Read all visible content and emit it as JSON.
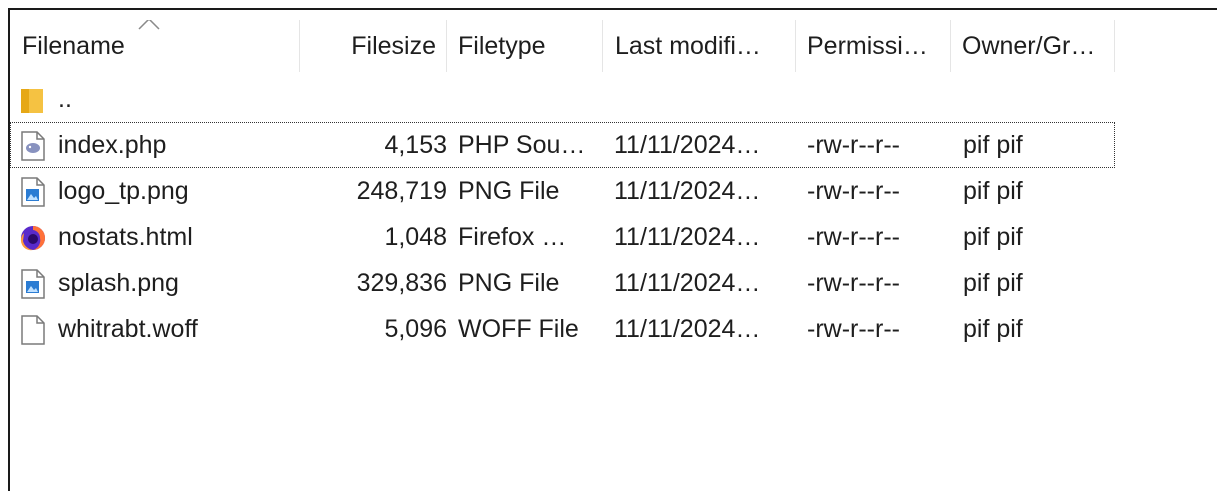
{
  "columns": {
    "filename": "Filename",
    "filesize": "Filesize",
    "filetype": "Filetype",
    "last_modified": "Last modifi…",
    "permissions": "Permissi…",
    "owner_group": "Owner/Gr…"
  },
  "sort": {
    "column": "filename",
    "direction": "ascending"
  },
  "rows": [
    {
      "name": "..",
      "size": "",
      "type": "",
      "modified": "",
      "permissions": "",
      "owner": "",
      "icon": "folder-icon"
    },
    {
      "name": "index.php",
      "size": "4,153",
      "type": "PHP Sou…",
      "modified": "11/11/2024…",
      "permissions": "-rw-r--r--",
      "owner": "pif pif",
      "icon": "php-file-icon"
    },
    {
      "name": "logo_tp.png",
      "size": "248,719",
      "type": "PNG File",
      "modified": "11/11/2024…",
      "permissions": "-rw-r--r--",
      "owner": "pif pif",
      "icon": "image-file-icon"
    },
    {
      "name": "nostats.html",
      "size": "1,048",
      "type": "Firefox …",
      "modified": "11/11/2024…",
      "permissions": "-rw-r--r--",
      "owner": "pif pif",
      "icon": "firefox-icon"
    },
    {
      "name": "splash.png",
      "size": "329,836",
      "type": "PNG File",
      "modified": "11/11/2024…",
      "permissions": "-rw-r--r--",
      "owner": "pif pif",
      "icon": "image-file-icon"
    },
    {
      "name": "whitrabt.woff",
      "size": "5,096",
      "type": "WOFF File",
      "modified": "11/11/2024…",
      "permissions": "-rw-r--r--",
      "owner": "pif pif",
      "icon": "blank-file-icon"
    }
  ],
  "focused_row": 1,
  "colors": {
    "folder": "#f5c242",
    "php": "#8892bf",
    "image": "#2b7cd3",
    "firefox_orange": "#ff7139",
    "firefox_purple": "#592acb"
  }
}
